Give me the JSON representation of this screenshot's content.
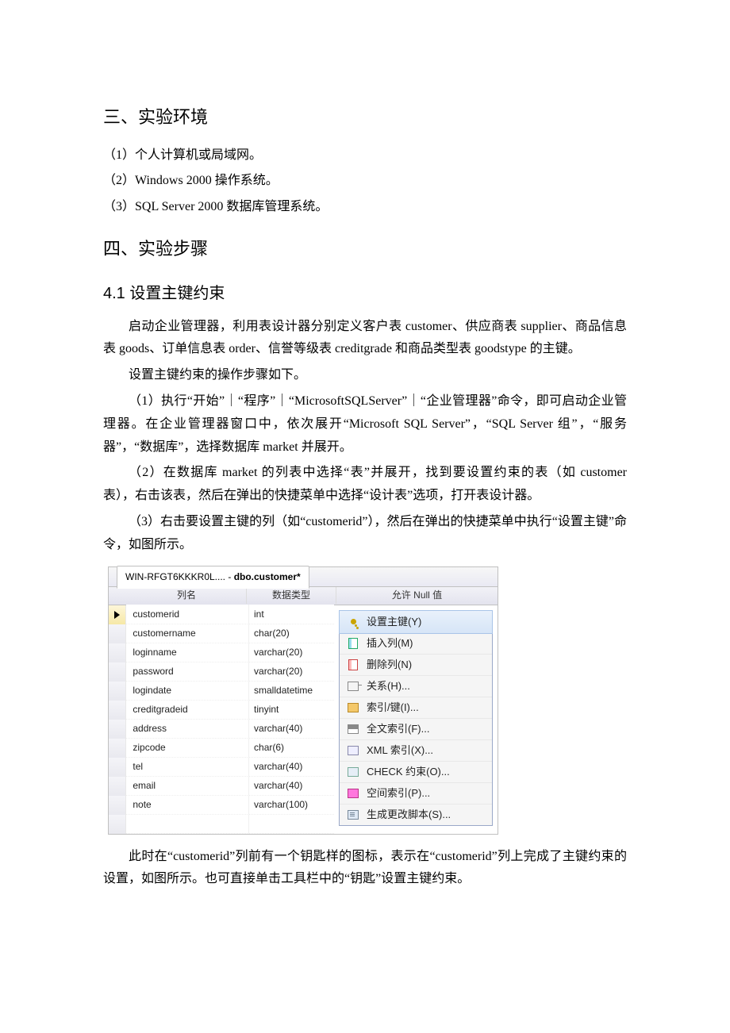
{
  "sec3_title": "三、实验环境",
  "env": {
    "i1": "（1）个人计算机或局域网。",
    "i2": "（2）Windows 2000 操作系统。",
    "i3": "（3）SQL Server 2000 数据库管理系统。"
  },
  "sec4_title": "四、实验步骤",
  "sec41_title": "4.1 设置主键约束",
  "para1": "启动企业管理器，利用表设计器分别定义客户表 customer、供应商表 supplier、商品信息表 goods、订单信息表 order、信誉等级表 creditgrade 和商品类型表 goodstype 的主键。",
  "para2": "设置主键约束的操作步骤如下。",
  "step1": "（1）执行“开始”｜“程序”｜“MicrosoftSQLServer”｜“企业管理器”命令，即可启动企业管理器。在企业管理器窗口中，依次展开“Microsoft SQL Server”，“SQL  Server 组”，“服务器”，“数据库”，选择数据库 market 并展开。",
  "step2": "（2）在数据库 market 的列表中选择“表”并展开，找到要设置约束的表（如 customer 表），右击该表，然后在弹出的快捷菜单中选择“设计表”选项，打开表设计器。",
  "step3": "（3）右击要设置主键的列（如“customerid”），然后在弹出的快捷菜单中执行“设置主键”命令，如图所示。",
  "designer": {
    "tab_prefix": "WIN-RFGT6KKKR0L.... - ",
    "tab_bold": "dbo.customer*",
    "header": {
      "col1": "列名",
      "col2": "数据类型",
      "col3": "允许 Null 值"
    },
    "rows": [
      {
        "name": "customerid",
        "type": "int",
        "selected": true
      },
      {
        "name": "customername",
        "type": "char(20)",
        "selected": false
      },
      {
        "name": "loginname",
        "type": "varchar(20)",
        "selected": false
      },
      {
        "name": "password",
        "type": "varchar(20)",
        "selected": false
      },
      {
        "name": "logindate",
        "type": "smalldatetime",
        "selected": false
      },
      {
        "name": "creditgradeid",
        "type": "tinyint",
        "selected": false
      },
      {
        "name": "address",
        "type": "varchar(40)",
        "selected": false
      },
      {
        "name": "zipcode",
        "type": "char(6)",
        "selected": false
      },
      {
        "name": "tel",
        "type": "varchar(40)",
        "selected": false
      },
      {
        "name": "email",
        "type": "varchar(40)",
        "selected": false
      },
      {
        "name": "note",
        "type": "varchar(100)",
        "selected": false
      },
      {
        "name": "",
        "type": "",
        "selected": false
      }
    ],
    "menu": [
      {
        "label": "设置主键(Y)",
        "icon": "key-icon",
        "highlight": true
      },
      {
        "label": "插入列(M)",
        "icon": "insert-col-icon",
        "highlight": false
      },
      {
        "label": "删除列(N)",
        "icon": "delete-col-icon",
        "highlight": false
      },
      {
        "label": "关系(H)...",
        "icon": "relation-icon",
        "highlight": false
      },
      {
        "label": "索引/键(I)...",
        "icon": "index-icon",
        "highlight": false
      },
      {
        "label": "全文索引(F)...",
        "icon": "fulltext-icon",
        "highlight": false
      },
      {
        "label": "XML 索引(X)...",
        "icon": "xml-icon",
        "highlight": false
      },
      {
        "label": "CHECK 约束(O)...",
        "icon": "check-icon",
        "highlight": false
      },
      {
        "label": "空间索引(P)...",
        "icon": "spatial-icon",
        "highlight": false
      },
      {
        "label": "生成更改脚本(S)...",
        "icon": "script-icon",
        "highlight": false
      }
    ]
  },
  "para_after": "此时在“customerid”列前有一个钥匙样的图标，表示在“customerid”列上完成了主键约束的设置，如图所示。也可直接单击工具栏中的“钥匙”设置主键约束。"
}
